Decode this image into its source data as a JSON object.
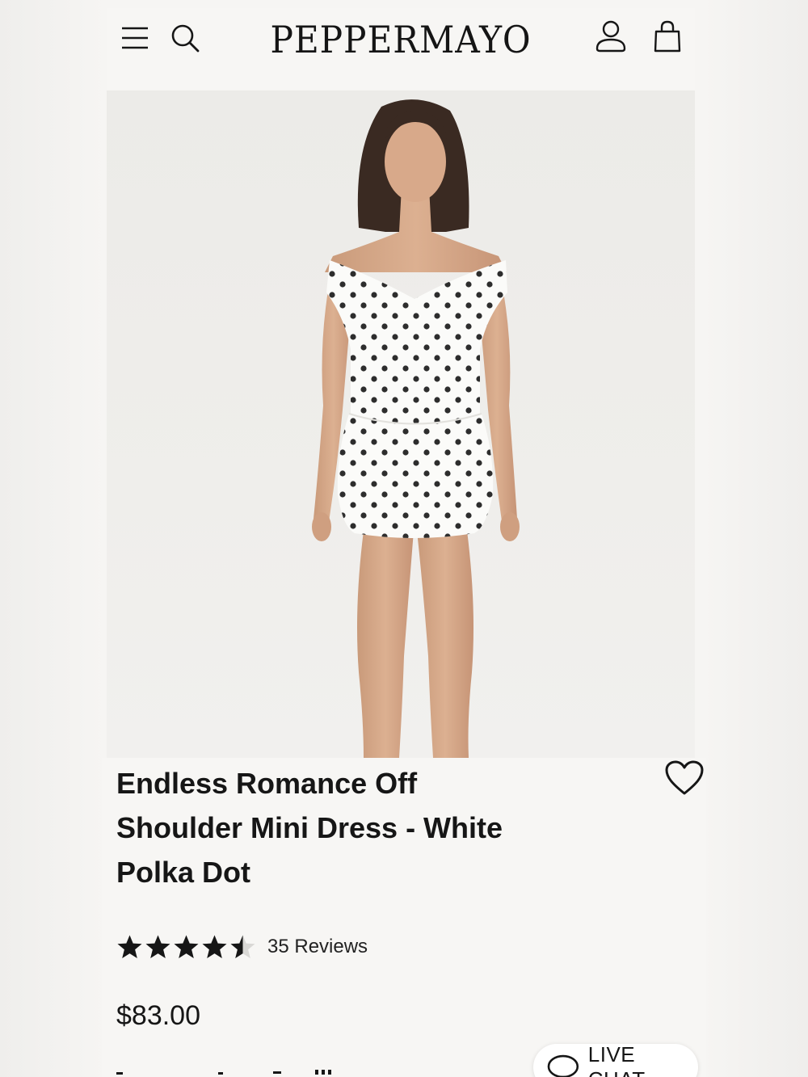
{
  "header": {
    "logo": "PEPPERMAYO",
    "icons": [
      "menu-icon",
      "search-icon",
      "account-icon",
      "bag-icon"
    ]
  },
  "product": {
    "title_lines": [
      "Endless Romance Off",
      "Shoulder Mini Dress - White",
      "Polka Dot"
    ],
    "rating": 4.5,
    "rating_max": 5,
    "reviews_label": "35 Reviews",
    "price": "$83.00"
  },
  "live_chat": {
    "label": "LIVE CHAT"
  },
  "colors": {
    "text": "#161616",
    "page_background": "#f6f5f3",
    "hero_background": "#eeedea",
    "dress_white": "#fbfbf9",
    "dot": "#161616"
  }
}
